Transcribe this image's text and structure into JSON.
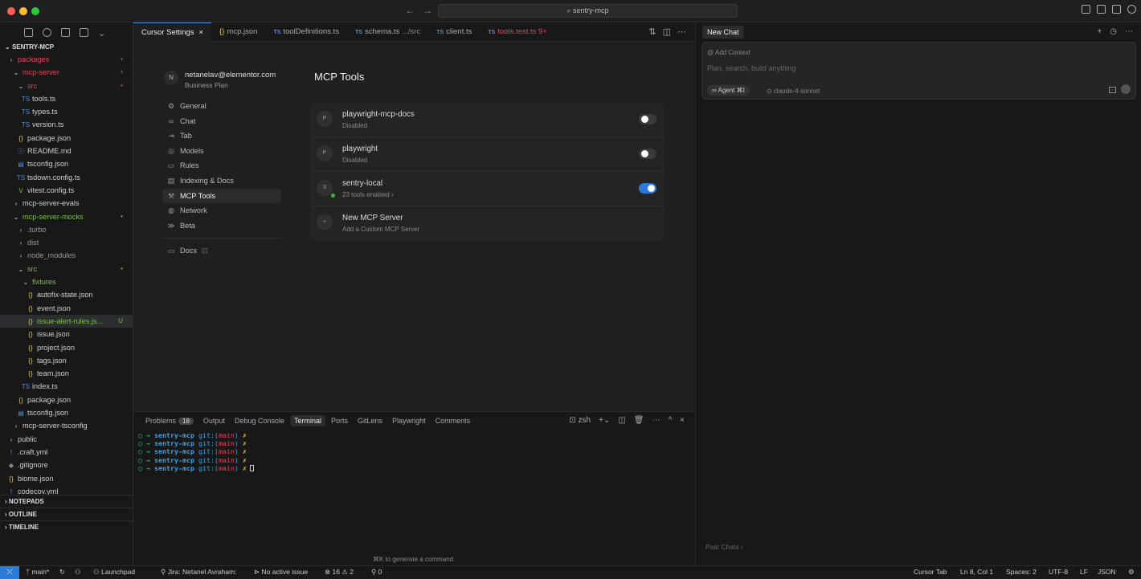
{
  "window": {
    "search": "sentry-mcp"
  },
  "explorer": {
    "root": "SENTRY-MCP",
    "items": [
      {
        "label": "packages",
        "ic": "›",
        "indent": 1,
        "color": "#e0465c",
        "badge": "•"
      },
      {
        "label": "mcp-server",
        "ic": "⌄",
        "indent": 2,
        "color": "#e0465c",
        "badge": "•"
      },
      {
        "label": "src",
        "ic": "⌄",
        "indent": 3,
        "color": "#e0465c",
        "badge": "•"
      },
      {
        "label": "tools.ts",
        "ic": "TS",
        "indent": 4,
        "color": "#cfcfcf",
        "icColor": "#4a90e2",
        "badge": ""
      },
      {
        "label": "types.ts",
        "ic": "TS",
        "indent": 4,
        "color": "#cfcfcf",
        "icColor": "#4a90e2",
        "badge": ""
      },
      {
        "label": "version.ts",
        "ic": "TS",
        "indent": 4,
        "color": "#cfcfcf",
        "icColor": "#4a90e2",
        "badge": ""
      },
      {
        "label": "package.json",
        "ic": "{}",
        "indent": 3,
        "color": "#cfcfcf",
        "icColor": "#e7c547",
        "badge": ""
      },
      {
        "label": "README.md",
        "ic": "ⓘ",
        "indent": 3,
        "color": "#cfcfcf",
        "icColor": "#4a90e2",
        "badge": ""
      },
      {
        "label": "tsconfig.json",
        "ic": "▤",
        "indent": 3,
        "color": "#cfcfcf",
        "icColor": "#4a90e2",
        "badge": ""
      },
      {
        "label": "tsdown.config.ts",
        "ic": "TS",
        "indent": 3,
        "color": "#cfcfcf",
        "icColor": "#4a90e2",
        "badge": ""
      },
      {
        "label": "vitest.config.ts",
        "ic": "V",
        "indent": 3,
        "color": "#cfcfcf",
        "icColor": "#7ec14a",
        "badge": ""
      },
      {
        "label": "mcp-server-evals",
        "ic": "›",
        "indent": 2,
        "color": "#cfcfcf",
        "badge": ""
      },
      {
        "label": "mcp-server-mocks",
        "ic": "⌄",
        "indent": 2,
        "color": "#7ec14a",
        "badge": "•"
      },
      {
        "label": ".turbo",
        "ic": "›",
        "indent": 3,
        "color": "#999",
        "badge": ""
      },
      {
        "label": "dist",
        "ic": "›",
        "indent": 3,
        "color": "#999",
        "badge": ""
      },
      {
        "label": "node_modules",
        "ic": "›",
        "indent": 3,
        "color": "#999",
        "badge": ""
      },
      {
        "label": "src",
        "ic": "⌄",
        "indent": 3,
        "color": "#7ec14a",
        "badge": "•"
      },
      {
        "label": "fixtures",
        "ic": "⌄",
        "indent": 4,
        "color": "#7ec14a",
        "badge": ""
      },
      {
        "label": "autofix-state.json",
        "ic": "{}",
        "indent": 5,
        "color": "#cfcfcf",
        "icColor": "#e7c547",
        "badge": ""
      },
      {
        "label": "event.json",
        "ic": "{}",
        "indent": 5,
        "color": "#cfcfcf",
        "icColor": "#e7c547",
        "badge": ""
      },
      {
        "label": "issue-alert-rules.js...",
        "ic": "{}",
        "indent": 5,
        "color": "#7ec14a",
        "icColor": "#e7c547",
        "badge": "U",
        "sel": true
      },
      {
        "label": "issue.json",
        "ic": "{}",
        "indent": 5,
        "color": "#cfcfcf",
        "icColor": "#e7c547",
        "badge": ""
      },
      {
        "label": "project.json",
        "ic": "{}",
        "indent": 5,
        "color": "#cfcfcf",
        "icColor": "#e7c547",
        "badge": ""
      },
      {
        "label": "tags.json",
        "ic": "{}",
        "indent": 5,
        "color": "#cfcfcf",
        "icColor": "#e7c547",
        "badge": ""
      },
      {
        "label": "team.json",
        "ic": "{}",
        "indent": 5,
        "color": "#cfcfcf",
        "icColor": "#e7c547",
        "badge": ""
      },
      {
        "label": "index.ts",
        "ic": "TS",
        "indent": 4,
        "color": "#cfcfcf",
        "icColor": "#4a90e2",
        "badge": ""
      },
      {
        "label": "package.json",
        "ic": "{}",
        "indent": 3,
        "color": "#cfcfcf",
        "icColor": "#e7c547",
        "badge": ""
      },
      {
        "label": "tsconfig.json",
        "ic": "▤",
        "indent": 3,
        "color": "#cfcfcf",
        "icColor": "#4a90e2",
        "badge": ""
      },
      {
        "label": "mcp-server-tsconfig",
        "ic": "›",
        "indent": 2,
        "color": "#cfcfcf",
        "badge": ""
      },
      {
        "label": "public",
        "ic": "›",
        "indent": 1,
        "color": "#cfcfcf",
        "badge": ""
      },
      {
        "label": ".craft.yml",
        "ic": "!",
        "indent": 1,
        "color": "#cfcfcf",
        "icColor": "#b07cd8",
        "badge": ""
      },
      {
        "label": ".gitignore",
        "ic": "◆",
        "indent": 1,
        "color": "#cfcfcf",
        "icColor": "#888",
        "badge": ""
      },
      {
        "label": "biome.json",
        "ic": "{}",
        "indent": 1,
        "color": "#cfcfcf",
        "icColor": "#e7c547",
        "badge": ""
      },
      {
        "label": "codecov.yml",
        "ic": "!",
        "indent": 1,
        "color": "#cfcfcf",
        "icColor": "#b07cd8",
        "badge": ""
      },
      {
        "label": "Dockerfile",
        "ic": "◆",
        "indent": 1,
        "color": "#cfcfcf",
        "icColor": "#4a90e2",
        "badge": ""
      },
      {
        "label": "LICENSE.md",
        "ic": "♗",
        "indent": 1,
        "color": "#cfcfcf",
        "icColor": "#e7c547",
        "badge": ""
      },
      {
        "label": "package.json",
        "ic": "{}",
        "indent": 1,
        "color": "#cfcfcf",
        "icColor": "#e7c547",
        "badge": ""
      }
    ],
    "sections": [
      "NOTEPADS",
      "OUTLINE",
      "TIMELINE"
    ]
  },
  "tabs": [
    {
      "label": "Cursor Settings",
      "prefix": "",
      "close": "×",
      "active": true
    },
    {
      "label": "mcp.json",
      "prefix": "{}",
      "close": ""
    },
    {
      "label": "toolDefinitions.ts",
      "prefix": "TS",
      "close": ""
    },
    {
      "label": "schema.ts",
      "prefix": "TS",
      "suffix": " .../src",
      "close": ""
    },
    {
      "label": "client.ts",
      "prefix": "TS",
      "close": ""
    },
    {
      "label": "tools.test.ts",
      "prefix": "TS",
      "suffix": " 9+",
      "close": "",
      "red": true
    }
  ],
  "settings": {
    "account": {
      "initial": "N",
      "email": "netanelav@elementor.com",
      "plan": "Business Plan"
    },
    "nav": [
      {
        "label": "General",
        "icon": "⚙"
      },
      {
        "label": "Chat",
        "icon": "∞"
      },
      {
        "label": "Tab",
        "icon": "⇥"
      },
      {
        "label": "Models",
        "icon": "◎"
      },
      {
        "label": "Rules",
        "icon": "▭"
      },
      {
        "label": "Indexing & Docs",
        "icon": "▤"
      },
      {
        "label": "MCP Tools",
        "icon": "⚒",
        "active": true
      },
      {
        "label": "Network",
        "icon": "◍"
      },
      {
        "label": "Beta",
        "icon": "≫"
      }
    ],
    "docs": {
      "label": "Docs",
      "icon": "▭",
      "ext": "⊡"
    },
    "title": "MCP Tools",
    "servers": [
      {
        "initial": "P",
        "name": "playwright-mcp-docs",
        "sub": "Disabled",
        "on": false,
        "dot": false
      },
      {
        "initial": "P",
        "name": "playwright",
        "sub": "Disabled",
        "on": false,
        "dot": false
      },
      {
        "initial": "S",
        "name": "sentry-local",
        "sub": "23 tools enabled  ›",
        "on": true,
        "dot": true
      },
      {
        "initial": "+",
        "name": "New MCP Server",
        "sub": "Add a Custom MCP Server",
        "on": null,
        "dot": false
      }
    ]
  },
  "panel": {
    "tabs": [
      {
        "label": "Problems",
        "badge": "18"
      },
      {
        "label": "Output"
      },
      {
        "label": "Debug Console"
      },
      {
        "label": "Terminal",
        "active": true
      },
      {
        "label": "Ports"
      },
      {
        "label": "GitLens"
      },
      {
        "label": "Playwright"
      },
      {
        "label": "Comments"
      }
    ],
    "shell": "zsh",
    "lines": 5,
    "prompt": {
      "arrow": "○ →",
      "dir": "sentry-mcp",
      "git": "git:(",
      "branch": "main",
      "close": ")",
      "mark": "✗"
    },
    "hint": "⌘K to generate a command"
  },
  "chat": {
    "tab": "New Chat",
    "context": "@ Add Context",
    "placeholder": "Plan, search, build anything",
    "agent": "∞ Agent ⌘I",
    "model": "⊙ claude-4-sonnet",
    "past": "Past Chats  ›"
  },
  "status": {
    "remote": "⤫",
    "branch": "ᛘ main*",
    "sync": "↻",
    "launchpad": "⚇ Launchpad",
    "jira": "⚲ Jira: Netanel Avraham:",
    "issue": "⊳ No active issue",
    "errors": "⊗ 16 ⚠ 2",
    "ports": "⚲ 0",
    "cursorTab": "Cursor Tab",
    "pos": "Ln 8, Col 1",
    "spaces": "Spaces: 2",
    "enc": "UTF-8",
    "eol": "LF",
    "lang": "JSON",
    "bell": "⚙"
  }
}
